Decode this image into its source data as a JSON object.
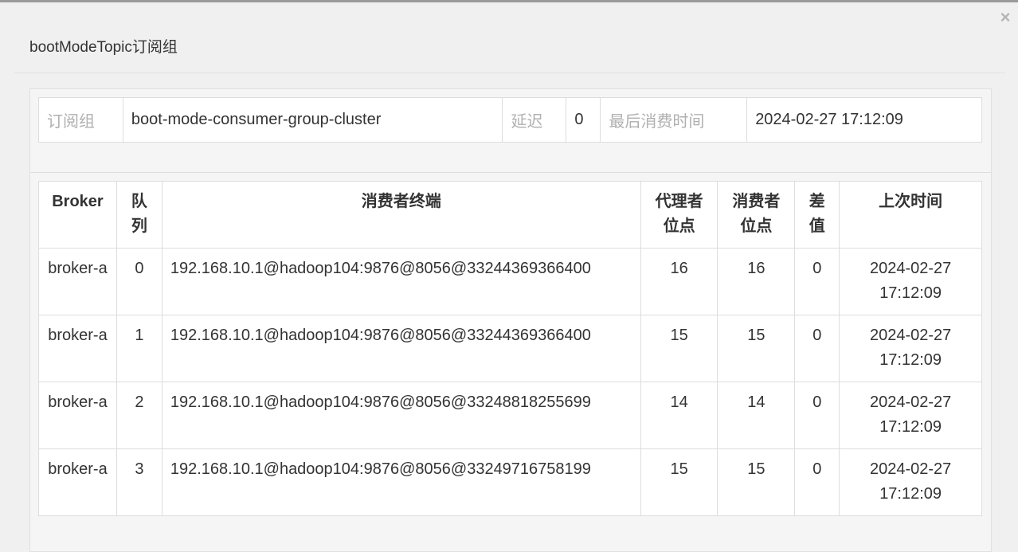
{
  "dialog": {
    "title": "bootModeTopic订阅组",
    "close_icon": "close-icon",
    "close_glyph": "×"
  },
  "summary": {
    "group_label": "订阅组",
    "group_value": "boot-mode-consumer-group-cluster",
    "delay_label": "延迟",
    "delay_value": "0",
    "last_consume_label": "最后消费时间",
    "last_consume_value": "2024-02-27 17:12:09"
  },
  "table": {
    "headers": {
      "broker": "Broker",
      "queue": "队列",
      "client": "消费者终端",
      "broker_offset": "代理者位点",
      "consumer_offset": "消费者位点",
      "diff": "差值",
      "last_time": "上次时间"
    },
    "rows": [
      {
        "broker": "broker-a",
        "queue": "0",
        "client": "192.168.10.1@hadoop104:9876@8056@33244369366400",
        "broker_offset": "16",
        "consumer_offset": "16",
        "diff": "0",
        "last_time": "2024-02-27 17:12:09"
      },
      {
        "broker": "broker-a",
        "queue": "1",
        "client": "192.168.10.1@hadoop104:9876@8056@33244369366400",
        "broker_offset": "15",
        "consumer_offset": "15",
        "diff": "0",
        "last_time": "2024-02-27 17:12:09"
      },
      {
        "broker": "broker-a",
        "queue": "2",
        "client": "192.168.10.1@hadoop104:9876@8056@33248818255699",
        "broker_offset": "14",
        "consumer_offset": "14",
        "diff": "0",
        "last_time": "2024-02-27 17:12:09"
      },
      {
        "broker": "broker-a",
        "queue": "3",
        "client": "192.168.10.1@hadoop104:9876@8056@33249716758199",
        "broker_offset": "15",
        "consumer_offset": "15",
        "diff": "0",
        "last_time": "2024-02-27 17:12:09"
      }
    ]
  }
}
